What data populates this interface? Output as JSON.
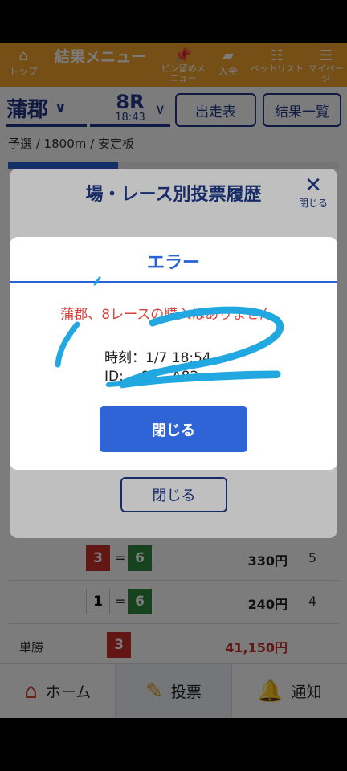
{
  "header": {
    "top_label": "トップ",
    "title": "結果メニュー",
    "pin_label": "ピン留めメニュー",
    "deposit_label": "入金",
    "pet_label": "ベットリスト",
    "mypage_label": "マイページ"
  },
  "race": {
    "venue": "蒲郡",
    "race_no": "8R",
    "time": "18:43",
    "entry_label": "出走表",
    "results_label": "結果一覧",
    "breadcrumb": "予選 / 1800m / 安定板"
  },
  "history_dialog": {
    "title": "場・レース別投票履歴",
    "close_x_label": "閉じる",
    "close_button": "閉じる"
  },
  "error_dialog": {
    "title": "エラー",
    "message": "蒲郡、8レースの購入はありません。",
    "time_text": "時刻：1/7 18:54",
    "id_text": "ID: ...94 - A82",
    "close_button": "閉じる"
  },
  "results": {
    "rows": [
      {
        "first": "3",
        "second": "6",
        "amount": "330円",
        "rank": "5"
      },
      {
        "first": "1",
        "second": "6",
        "amount": "240円",
        "rank": "4"
      }
    ],
    "win_label": "単勝",
    "win_number": "3",
    "win_amount": "41,150円"
  },
  "bottom_nav": {
    "home": "ホーム",
    "vote": "投票",
    "notify": "通知"
  },
  "colors": {
    "accent": "#2a63d4",
    "header": "#f0a32e",
    "error": "#d9423b",
    "navy": "#1f3a8a",
    "scribble": "#22a8e0"
  }
}
